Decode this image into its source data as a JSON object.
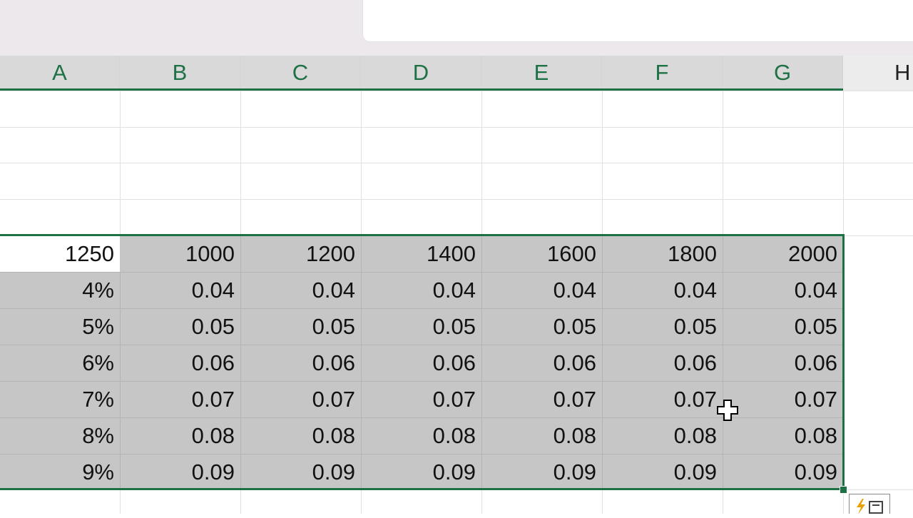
{
  "columns": {
    "A": "A",
    "B": "B",
    "C": "C",
    "D": "D",
    "E": "E",
    "F": "F",
    "G": "G",
    "H": "H"
  },
  "header_row": [
    "1250",
    "1000",
    "1200",
    "1400",
    "1600",
    "1800",
    "2000"
  ],
  "rows": [
    [
      "4%",
      "0.04",
      "0.04",
      "0.04",
      "0.04",
      "0.04",
      "0.04"
    ],
    [
      "5%",
      "0.05",
      "0.05",
      "0.05",
      "0.05",
      "0.05",
      "0.05"
    ],
    [
      "6%",
      "0.06",
      "0.06",
      "0.06",
      "0.06",
      "0.06",
      "0.06"
    ],
    [
      "7%",
      "0.07",
      "0.07",
      "0.07",
      "0.07",
      "0.07",
      "0.07"
    ],
    [
      "8%",
      "0.08",
      "0.08",
      "0.08",
      "0.08",
      "0.08",
      "0.08"
    ],
    [
      "9%",
      "0.09",
      "0.09",
      "0.09",
      "0.09",
      "0.09",
      "0.09"
    ]
  ],
  "colors": {
    "selection_border": "#1e7145",
    "selection_fill": "#c6c6c6",
    "column_header_bg": "#e6e6e6"
  },
  "icons": {
    "cursor": "cell-select-cursor-icon",
    "quick_analysis": "quick-analysis-icon"
  }
}
